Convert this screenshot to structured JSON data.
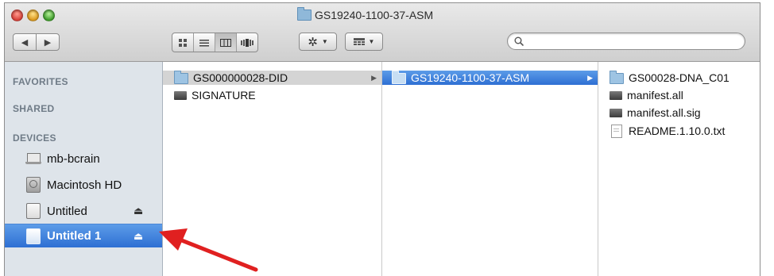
{
  "window": {
    "title": "GS19240-1100-37-ASM"
  },
  "toolbar": {
    "back_icon": "chevron-left-icon",
    "forward_icon": "chevron-right-icon",
    "view_modes": [
      "icon-view-icon",
      "list-view-icon",
      "column-view-icon",
      "cover-flow-icon"
    ],
    "active_view": "column-view-icon",
    "action_icon": "gear-icon",
    "arrange_icon": "arrange-icon",
    "search": {
      "value": "",
      "placeholder": ""
    }
  },
  "sidebar": {
    "sections": {
      "favorites": "FAVORITES",
      "shared": "SHARED",
      "devices": "DEVICES"
    },
    "devices": [
      {
        "label": "mb-bcrain",
        "icon": "laptop-icon"
      },
      {
        "label": "Macintosh HD",
        "icon": "hard-drive-icon"
      },
      {
        "label": "Untitled",
        "icon": "external-drive-icon",
        "eject": "⏏"
      },
      {
        "label": "Untitled 1",
        "icon": "external-drive-icon",
        "eject": "⏏",
        "selected": true
      }
    ]
  },
  "columns": {
    "col1": [
      {
        "name": "GS000000028-DID",
        "icon": "folder-icon",
        "has_children": true,
        "state": "path"
      },
      {
        "name": "SIGNATURE",
        "icon": "file-icon"
      }
    ],
    "col2": [
      {
        "name": "GS19240-1100-37-ASM",
        "icon": "folder-icon",
        "has_children": true,
        "state": "selected"
      }
    ],
    "col3": [
      {
        "name": "GS00028-DNA_C01",
        "icon": "folder-icon"
      },
      {
        "name": "manifest.all",
        "icon": "file-icon"
      },
      {
        "name": "manifest.all.sig",
        "icon": "file-icon"
      },
      {
        "name": "README.1.10.0.txt",
        "icon": "text-file-icon"
      }
    ]
  },
  "colors": {
    "selection": "#2e6fd3",
    "sidebar_bg": "#dee4ea",
    "annotation_arrow": "#e02020"
  }
}
